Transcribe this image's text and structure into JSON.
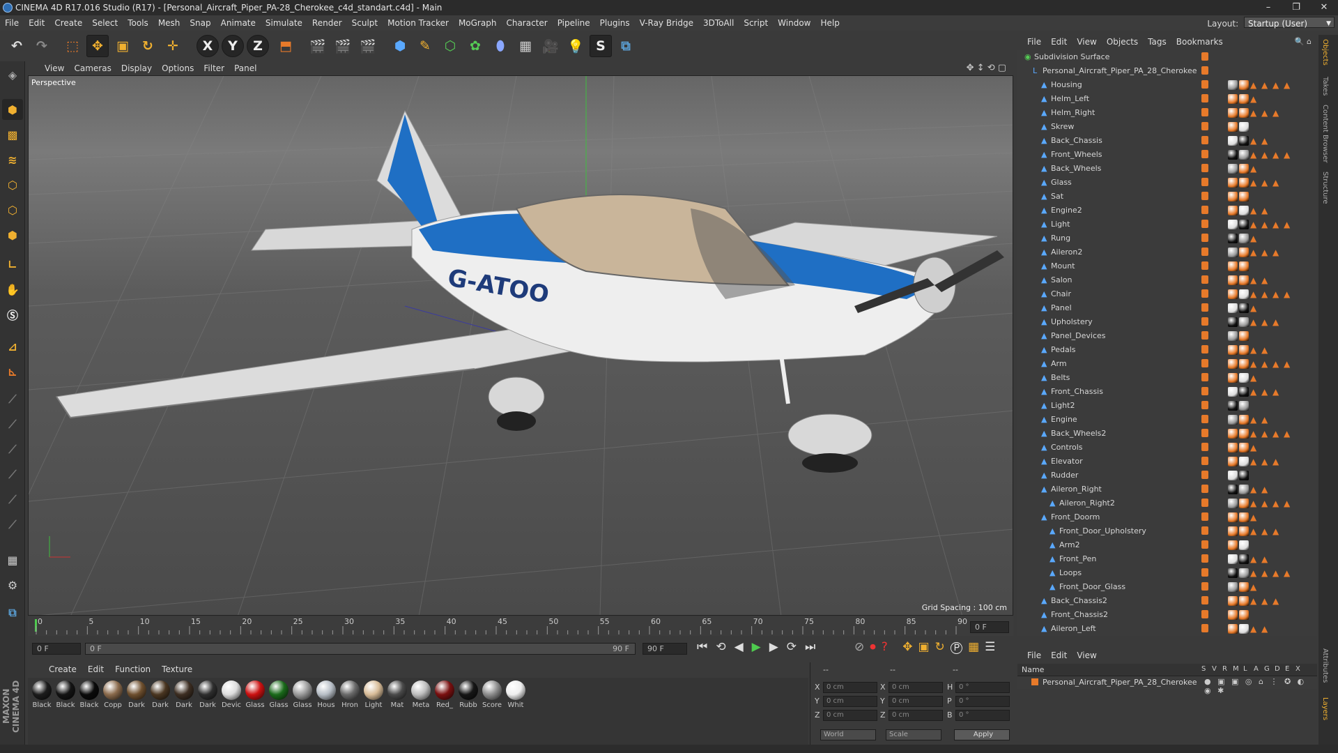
{
  "window": {
    "title": "CINEMA 4D R17.016 Studio (R17) - [Personal_Aircraft_Piper_PA-28_Cherokee_c4d_standart.c4d] - Main",
    "min": "–",
    "max": "❐",
    "close": "✕"
  },
  "menu": [
    "File",
    "Edit",
    "Create",
    "Select",
    "Tools",
    "Mesh",
    "Snap",
    "Animate",
    "Simulate",
    "Render",
    "Sculpt",
    "Motion Tracker",
    "MoGraph",
    "Character",
    "Pipeline",
    "Plugins",
    "V-Ray Bridge",
    "3DToAll",
    "Script",
    "Window",
    "Help"
  ],
  "layout": {
    "label": "Layout:",
    "value": "Startup (User)"
  },
  "toolbar": {
    "x": "X",
    "y": "Y",
    "z": "Z"
  },
  "viewport": {
    "menu": [
      "View",
      "Cameras",
      "Display",
      "Options",
      "Filter",
      "Panel"
    ],
    "label": "Perspective",
    "grid_spacing": "Grid Spacing : 100 cm",
    "registration": "G-ATOO"
  },
  "timeline": {
    "ticks": [
      "0",
      "5",
      "10",
      "15",
      "20",
      "25",
      "30",
      "35",
      "40",
      "45",
      "50",
      "55",
      "60",
      "65",
      "70",
      "75",
      "80",
      "85",
      "90"
    ],
    "end_field": "0 F",
    "start_field": "0 F",
    "range_left": "0 F",
    "range_right": "90 F",
    "max_field": "90 F"
  },
  "materials": {
    "menu": [
      "Create",
      "Edit",
      "Function",
      "Texture"
    ],
    "items": [
      {
        "name": "Black",
        "color": "#1c1c1c"
      },
      {
        "name": "Black",
        "color": "#141414"
      },
      {
        "name": "Black",
        "color": "#0a0a0a"
      },
      {
        "name": "Copp",
        "color": "#8a6a4c"
      },
      {
        "name": "Dark",
        "color": "#6e4f2e"
      },
      {
        "name": "Dark",
        "color": "#4a3621"
      },
      {
        "name": "Dark",
        "color": "#3d2e22"
      },
      {
        "name": "Dark",
        "color": "#2e2e2e"
      },
      {
        "name": "Devic",
        "color": "#dddddd"
      },
      {
        "name": "Glass",
        "color": "#cc1111"
      },
      {
        "name": "Glass",
        "color": "#1a6a1a"
      },
      {
        "name": "Glass",
        "color": "#9a9a9a"
      },
      {
        "name": "Hous",
        "color": "#b7bec6"
      },
      {
        "name": "Hron",
        "color": "#6a6a6a"
      },
      {
        "name": "Light",
        "color": "#d8bc98"
      },
      {
        "name": "Mat",
        "color": "#4a4a4a"
      },
      {
        "name": "Meta",
        "color": "#bdbdbd"
      },
      {
        "name": "Red_",
        "color": "#7a1010"
      },
      {
        "name": "Rubb",
        "color": "#161616"
      },
      {
        "name": "Score",
        "color": "#8d8d8d"
      },
      {
        "name": "Whit",
        "color": "#eeeeee"
      }
    ]
  },
  "coords": {
    "rows": [
      {
        "a": "X",
        "av": "0 cm",
        "b": "X",
        "bv": "0 cm",
        "c": "H",
        "cv": "0 °"
      },
      {
        "a": "Y",
        "av": "0 cm",
        "b": "Y",
        "bv": "0 cm",
        "c": "P",
        "cv": "0 °"
      },
      {
        "a": "Z",
        "av": "0 cm",
        "b": "Z",
        "bv": "0 cm",
        "c": "B",
        "cv": "0 °"
      }
    ],
    "world": "World",
    "scale": "Scale",
    "apply": "Apply",
    "hdr1": "--",
    "hdr2": "--",
    "hdr3": "--"
  },
  "objects": {
    "menu": [
      "File",
      "Edit",
      "View",
      "Objects",
      "Tags",
      "Bookmarks"
    ],
    "items": [
      {
        "name": "Subdivision Surface",
        "level": 0
      },
      {
        "name": "Personal_Aircraft_Piper_PA_28_Cherokee",
        "level": 1
      },
      {
        "name": "Housing",
        "level": 2
      },
      {
        "name": "Helm_Left",
        "level": 2
      },
      {
        "name": "Helm_Right",
        "level": 2
      },
      {
        "name": "Skrew",
        "level": 2
      },
      {
        "name": "Back_Chassis",
        "level": 2
      },
      {
        "name": "Front_Wheels",
        "level": 2
      },
      {
        "name": "Back_Wheels",
        "level": 2
      },
      {
        "name": "Glass",
        "level": 2
      },
      {
        "name": "Sat",
        "level": 2
      },
      {
        "name": "Engine2",
        "level": 2
      },
      {
        "name": "Light",
        "level": 2
      },
      {
        "name": "Rung",
        "level": 2
      },
      {
        "name": "Aileron2",
        "level": 2
      },
      {
        "name": "Mount",
        "level": 2
      },
      {
        "name": "Salon",
        "level": 2
      },
      {
        "name": "Chair",
        "level": 2
      },
      {
        "name": "Panel",
        "level": 2
      },
      {
        "name": "Upholstery",
        "level": 2
      },
      {
        "name": "Panel_Devices",
        "level": 2
      },
      {
        "name": "Pedals",
        "level": 2
      },
      {
        "name": "Arm",
        "level": 2
      },
      {
        "name": "Belts",
        "level": 2
      },
      {
        "name": "Front_Chassis",
        "level": 2
      },
      {
        "name": "Light2",
        "level": 2
      },
      {
        "name": "Engine",
        "level": 2
      },
      {
        "name": "Back_Wheels2",
        "level": 2
      },
      {
        "name": "Controls",
        "level": 2
      },
      {
        "name": "Elevator",
        "level": 2
      },
      {
        "name": "Rudder",
        "level": 2
      },
      {
        "name": "Aileron_Right",
        "level": 2
      },
      {
        "name": "Aileron_Right2",
        "level": 3
      },
      {
        "name": "Front_Doorm",
        "level": 2
      },
      {
        "name": "Front_Door_Upholstery",
        "level": 3
      },
      {
        "name": "Arm2",
        "level": 3
      },
      {
        "name": "Front_Pen",
        "level": 3
      },
      {
        "name": "Loops",
        "level": 3
      },
      {
        "name": "Front_Door_Glass",
        "level": 3
      },
      {
        "name": "Back_Chassis2",
        "level": 2
      },
      {
        "name": "Front_Chassis2",
        "level": 2
      },
      {
        "name": "Aileron_Left",
        "level": 2
      }
    ]
  },
  "attributes": {
    "menu": [
      "File",
      "Edit",
      "View"
    ],
    "header": {
      "name": "Name",
      "cols": [
        "S",
        "V",
        "R",
        "M",
        "L",
        "A",
        "G",
        "D",
        "E",
        "X"
      ]
    },
    "row": "Personal_Aircraft_Piper_PA_28_Cherokee"
  },
  "side_tabs": [
    "Objects",
    "Takes",
    "Content Browser",
    "Structure"
  ],
  "side_tabs_bottom": [
    "Attributes",
    "Layers"
  ],
  "brand": "MAXON CINEMA 4D"
}
